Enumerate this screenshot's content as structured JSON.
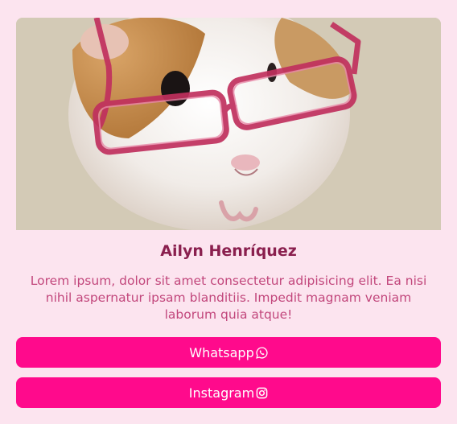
{
  "profile": {
    "name": "Ailyn Henríquez",
    "bio": "Lorem ipsum, dolor sit amet consectetur adipisicing elit. Ea nisi nihil aspernatur ipsam blanditiis. Impedit magnam veniam laborum quia atque!",
    "photo_icon": "guinea-pig-with-glasses-photo"
  },
  "links": {
    "whatsapp_label": "Whatsapp",
    "whatsapp_icon": "whatsapp-icon",
    "instagram_label": "Instagram",
    "instagram_icon": "instagram-icon"
  },
  "colors": {
    "background": "#fce4ef",
    "button": "#ff0a8c",
    "name_text": "#8a1f4e",
    "bio_text": "#c2477c"
  }
}
